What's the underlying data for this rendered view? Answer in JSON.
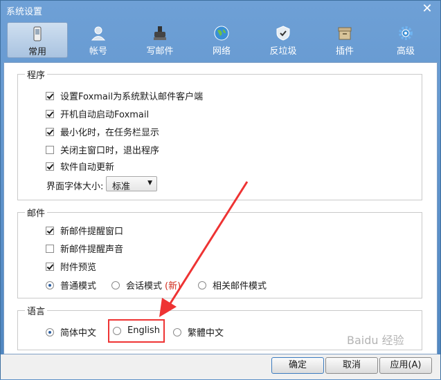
{
  "window": {
    "title": "系统设置"
  },
  "toolbar": {
    "items": [
      {
        "label": "常用",
        "icon": "phone-icon",
        "active": true
      },
      {
        "label": "帐号",
        "icon": "user-icon"
      },
      {
        "label": "写邮件",
        "icon": "stamp-icon"
      },
      {
        "label": "网络",
        "icon": "globe-icon"
      },
      {
        "label": "反垃圾",
        "icon": "shield-icon"
      },
      {
        "label": "插件",
        "icon": "box-icon"
      },
      {
        "label": "高级",
        "icon": "gear-icon"
      }
    ]
  },
  "program": {
    "legend": "程序",
    "options": [
      {
        "label": "设置Foxmail为系统默认邮件客户端",
        "checked": true
      },
      {
        "label": "开机自动启动Foxmail",
        "checked": true
      },
      {
        "label": "最小化时，在任务栏显示",
        "checked": true
      },
      {
        "label": "关闭主窗口时，退出程序",
        "checked": false
      },
      {
        "label": "软件自动更新",
        "checked": true
      }
    ],
    "font_size_label": "界面字体大小:",
    "font_size_value": "标准"
  },
  "mail": {
    "legend": "邮件",
    "options": [
      {
        "label": "新邮件提醒窗口",
        "checked": true
      },
      {
        "label": "新邮件提醒声音",
        "checked": false
      },
      {
        "label": "附件预览",
        "checked": true
      }
    ],
    "modes": [
      {
        "label": "普通模式",
        "selected": true
      },
      {
        "label": "会话模式",
        "selected": false,
        "tag": "(新)"
      },
      {
        "label": "相关邮件模式",
        "selected": false
      }
    ]
  },
  "language": {
    "legend": "语言",
    "options": [
      {
        "label": "简体中文",
        "selected": true
      },
      {
        "label": "English",
        "selected": false
      },
      {
        "label": "繁體中文",
        "selected": false
      }
    ]
  },
  "buttons": {
    "ok": "确定",
    "cancel": "取消",
    "apply": "应用(A)"
  },
  "watermark": "Baidu 经验",
  "colors": {
    "accent": "#2a5d9f",
    "highlight": "#e33333"
  }
}
